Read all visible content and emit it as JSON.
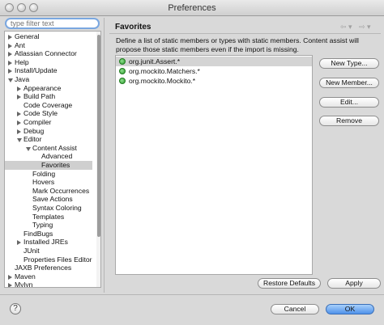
{
  "window": {
    "title": "Preferences"
  },
  "filter": {
    "placeholder": "type filter text",
    "value": ""
  },
  "tree": {
    "selected_label": "Favorites",
    "items": [
      {
        "label": "General",
        "level": 0,
        "arrow": "right"
      },
      {
        "label": "Ant",
        "level": 0,
        "arrow": "right"
      },
      {
        "label": "Atlassian Connector",
        "level": 0,
        "arrow": "right"
      },
      {
        "label": "Help",
        "level": 0,
        "arrow": "right"
      },
      {
        "label": "Install/Update",
        "level": 0,
        "arrow": "right"
      },
      {
        "label": "Java",
        "level": 0,
        "arrow": "down"
      },
      {
        "label": "Appearance",
        "level": 1,
        "arrow": "right"
      },
      {
        "label": "Build Path",
        "level": 1,
        "arrow": "right"
      },
      {
        "label": "Code Coverage",
        "level": 1,
        "arrow": ""
      },
      {
        "label": "Code Style",
        "level": 1,
        "arrow": "right"
      },
      {
        "label": "Compiler",
        "level": 1,
        "arrow": "right"
      },
      {
        "label": "Debug",
        "level": 1,
        "arrow": "right"
      },
      {
        "label": "Editor",
        "level": 1,
        "arrow": "down"
      },
      {
        "label": "Content Assist",
        "level": 2,
        "arrow": "down"
      },
      {
        "label": "Advanced",
        "level": 3,
        "arrow": ""
      },
      {
        "label": "Favorites",
        "level": 3,
        "arrow": ""
      },
      {
        "label": "Folding",
        "level": 2,
        "arrow": ""
      },
      {
        "label": "Hovers",
        "level": 2,
        "arrow": ""
      },
      {
        "label": "Mark Occurrences",
        "level": 2,
        "arrow": ""
      },
      {
        "label": "Save Actions",
        "level": 2,
        "arrow": ""
      },
      {
        "label": "Syntax Coloring",
        "level": 2,
        "arrow": ""
      },
      {
        "label": "Templates",
        "level": 2,
        "arrow": ""
      },
      {
        "label": "Typing",
        "level": 2,
        "arrow": ""
      },
      {
        "label": "FindBugs",
        "level": 1,
        "arrow": ""
      },
      {
        "label": "Installed JREs",
        "level": 1,
        "arrow": "right"
      },
      {
        "label": "JUnit",
        "level": 1,
        "arrow": ""
      },
      {
        "label": "Properties Files Editor",
        "level": 1,
        "arrow": ""
      },
      {
        "label": "JAXB Preferences",
        "level": 0,
        "arrow": ""
      },
      {
        "label": "Maven",
        "level": 0,
        "arrow": "right"
      },
      {
        "label": "Mylyn",
        "level": 0,
        "arrow": "right"
      }
    ]
  },
  "page": {
    "title": "Favorites",
    "description": "Define a list of static members or types with static members. Content assist will propose those static members even if the import is missing."
  },
  "favorites": [
    {
      "text": "org.junit.Assert.*",
      "selected": true
    },
    {
      "text": "org.mockito.Matchers.*",
      "selected": false
    },
    {
      "text": "org.mockito.Mockito.*",
      "selected": false
    }
  ],
  "buttons": {
    "new_type": "New Type...",
    "new_member": "New Member...",
    "edit": "Edit...",
    "remove": "Remove",
    "restore_defaults": "Restore Defaults",
    "apply": "Apply",
    "cancel": "Cancel",
    "ok": "OK",
    "help": "?"
  },
  "colors": {
    "accent": "#4f92ea",
    "selection": "#cfcfcf",
    "icon_green": "#2f9a2f"
  }
}
